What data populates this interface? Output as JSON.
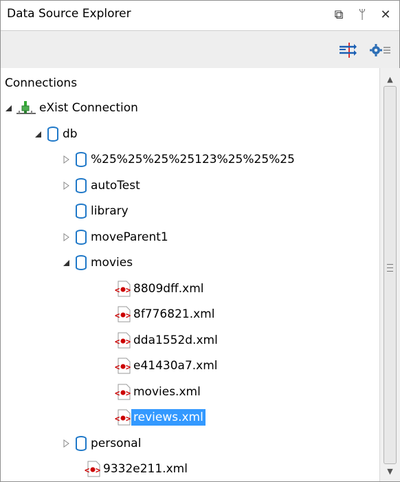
{
  "window": {
    "title": "Data Source Explorer",
    "restore_glyph": "⧉",
    "pin_glyph": "ᛘ",
    "close_glyph": "✕"
  },
  "toolbar": {
    "buttons": [
      {
        "name": "link-with-editor",
        "icon": "arrows-exchange-icon"
      },
      {
        "name": "configure",
        "icon": "gear-menu-icon"
      }
    ]
  },
  "tree": {
    "root_label": "Connections",
    "items": [
      {
        "label": "eXist Connection",
        "icon": "connection-icon",
        "state": "expanded",
        "level": 1
      },
      {
        "label": "db",
        "icon": "database-icon",
        "state": "expanded",
        "level": 2
      },
      {
        "label": "%25%25%25%25123%25%25%25",
        "icon": "database-icon",
        "state": "collapsed",
        "level": 3
      },
      {
        "label": "autoTest",
        "icon": "database-icon",
        "state": "collapsed",
        "level": 3
      },
      {
        "label": "library",
        "icon": "database-icon",
        "state": "leaf",
        "level": 3
      },
      {
        "label": "moveParent1",
        "icon": "database-icon",
        "state": "collapsed",
        "level": 3
      },
      {
        "label": "movies",
        "icon": "database-icon",
        "state": "expanded",
        "level": 3
      },
      {
        "label": "8809dff.xml",
        "icon": "xml-file-icon",
        "state": "leaf",
        "level": 4
      },
      {
        "label": "8f776821.xml",
        "icon": "xml-file-icon",
        "state": "leaf",
        "level": 4
      },
      {
        "label": "dda1552d.xml",
        "icon": "xml-file-icon",
        "state": "leaf",
        "level": 4
      },
      {
        "label": "e41430a7.xml",
        "icon": "xml-file-icon",
        "state": "leaf",
        "level": 4
      },
      {
        "label": "movies.xml",
        "icon": "xml-file-icon",
        "state": "leaf",
        "level": 4
      },
      {
        "label": "reviews.xml",
        "icon": "xml-file-icon",
        "state": "leaf",
        "level": 4,
        "selected": true
      },
      {
        "label": "personal",
        "icon": "database-icon",
        "state": "collapsed",
        "level": 3
      },
      {
        "label": "9332e211.xml",
        "icon": "xml-file-icon",
        "state": "leaf",
        "level": 3
      }
    ]
  },
  "colors": {
    "selection": "#3399ff",
    "db_icon": "#1f78c8",
    "xml_icon": "#cc0000"
  }
}
